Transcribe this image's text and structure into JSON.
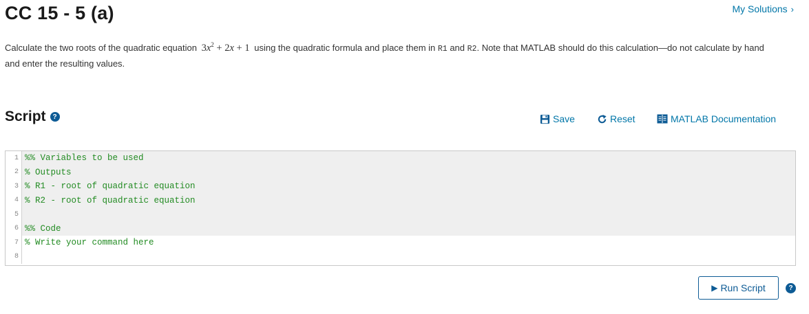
{
  "header": {
    "title": "CC 15 - 5 (a)",
    "my_solutions_label": "My Solutions",
    "my_solutions_chevron": "›"
  },
  "problem": {
    "text_before": "Calculate the two roots of the quadratic equation",
    "equation": {
      "coef_a": "3",
      "var": "x",
      "exp": "2",
      "plus1": "+",
      "coef_b": "2",
      "var_b": "x",
      "plus2": "+",
      "const": "1"
    },
    "text_middle": "using the quadratic formula and place them in",
    "var1": "R1",
    "and_text": "and",
    "var2": "R2",
    "text_after": ". Note that MATLAB should do this calculation—do not calculate by hand and enter the resulting values."
  },
  "script": {
    "heading": "Script",
    "help_glyph": "?"
  },
  "toolbar": {
    "save_label": "Save",
    "reset_label": "Reset",
    "docs_label": "MATLAB Documentation"
  },
  "editor": {
    "lines": [
      {
        "num": "1",
        "code": "%% Variables to be used",
        "shaded": true
      },
      {
        "num": "2",
        "code": "% Outputs",
        "shaded": true
      },
      {
        "num": "3",
        "code": "% R1 - root of quadratic equation",
        "shaded": true
      },
      {
        "num": "4",
        "code": "% R2 - root of quadratic equation",
        "shaded": true
      },
      {
        "num": "5",
        "code": "",
        "shaded": true
      },
      {
        "num": "6",
        "code": "%% Code",
        "shaded": true
      },
      {
        "num": "7",
        "code": "% Write your command here",
        "shaded": false
      },
      {
        "num": "8",
        "code": "",
        "shaded": false
      }
    ]
  },
  "footer": {
    "run_label": "Run Script",
    "run_glyph": "▶",
    "help_glyph": "?"
  },
  "colors": {
    "link": "#0076a8",
    "accent": "#0d5b95",
    "comment": "#228b22"
  }
}
